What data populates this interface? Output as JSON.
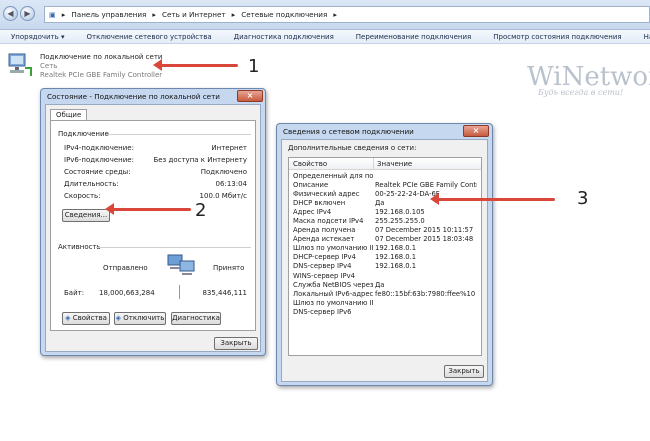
{
  "address_bar": {
    "crumbs": [
      "Панель управления",
      "Сеть и Интернет",
      "Сетевые подключения"
    ]
  },
  "command_bar": {
    "items": [
      "Упорядочить ▾",
      "Отключение сетевого устройства",
      "Диагностика подключения",
      "Переименование подключения",
      "Просмотр состояния подключения",
      "Настройка параметров"
    ]
  },
  "adapter": {
    "name": "Подключение по локальной сети",
    "network": "Сеть",
    "device": "Realtek PCIe GBE Family Controller"
  },
  "watermark": {
    "brand": "WiNetwork",
    "slogan": "Будь всегда в сети!"
  },
  "status_window": {
    "title": "Состояние - Подключение по локальной сети",
    "tab": "Общие",
    "section_connection": "Подключение",
    "rows": [
      {
        "label": "IPv4-подключение:",
        "value": "Интернет"
      },
      {
        "label": "IPv6-подключение:",
        "value": "Без доступа к Интернету"
      },
      {
        "label": "Состояние среды:",
        "value": "Подключено"
      },
      {
        "label": "Длительность:",
        "value": "06:13:04"
      },
      {
        "label": "Скорость:",
        "value": "100.0 Мбит/с"
      }
    ],
    "details_button": "Сведения...",
    "section_activity": "Активность",
    "sent_label": "Отправлено",
    "received_label": "Принято",
    "bytes_label": "Байт:",
    "bytes_sent": "18,000,663,284",
    "bytes_received": "835,446,111",
    "properties_button": "Свойства",
    "disable_button": "Отключить",
    "diagnostics_button": "Диагностика",
    "close_button": "Закрыть"
  },
  "details_window": {
    "title": "Сведения о сетевом подключении",
    "subtitle": "Дополнительные сведения о сети:",
    "col_property": "Свойство",
    "col_value": "Значение",
    "rows": [
      {
        "p": "Определенный для по...",
        "v": ""
      },
      {
        "p": "Описание",
        "v": "Realtek PCIe GBE Family Controller"
      },
      {
        "p": "Физический адрес",
        "v": "00-25-22-24-DA-6F"
      },
      {
        "p": "DHCP включен",
        "v": "Да"
      },
      {
        "p": "Адрес IPv4",
        "v": "192.168.0.105"
      },
      {
        "p": "Маска подсети IPv4",
        "v": "255.255.255.0"
      },
      {
        "p": "Аренда получена",
        "v": "07 December 2015 10:11:57"
      },
      {
        "p": "Аренда истекает",
        "v": "07 December 2015 18:03:48"
      },
      {
        "p": "Шлюз по умолчанию IP...",
        "v": "192.168.0.1"
      },
      {
        "p": "DHCP-сервер IPv4",
        "v": "192.168.0.1"
      },
      {
        "p": "DNS-сервер IPv4",
        "v": "192.168.0.1"
      },
      {
        "p": "WINS-сервер IPv4",
        "v": ""
      },
      {
        "p": "Служба NetBIOS через...",
        "v": "Да"
      },
      {
        "p": "Локальный IPv6-адрес...",
        "v": "fe80::15bf:63b:7980:ffee%10"
      },
      {
        "p": "Шлюз по умолчанию IP...",
        "v": ""
      },
      {
        "p": "DNS-сервер IPv6",
        "v": ""
      }
    ],
    "close_button": "Закрыть"
  },
  "annotations": {
    "n1": "1",
    "n2": "2",
    "n3": "3"
  },
  "colors": {
    "arrow": "#d9473a",
    "title_bg": "#c6d8ef"
  }
}
